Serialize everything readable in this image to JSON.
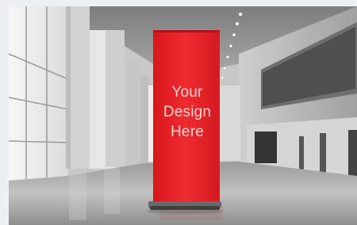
{
  "banner": {
    "lines": [
      "Your",
      "Design",
      "Here"
    ],
    "color": "#e8262b",
    "text_color": "#ffe3e3"
  },
  "scene": {
    "description_colors": {
      "floor": "#b9b9b9",
      "wall": "#d8d8d8",
      "column": "#c9c9c9",
      "glass": "#f4f4f4"
    }
  }
}
